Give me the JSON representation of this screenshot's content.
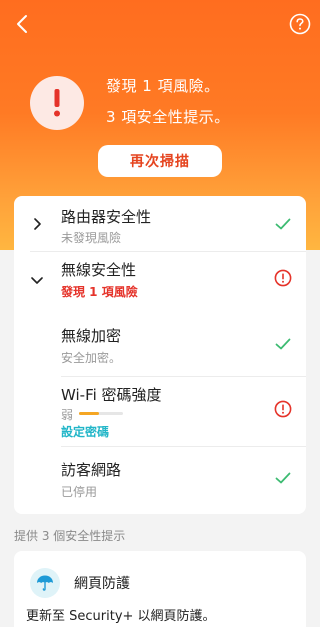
{
  "header": {
    "back_icon": "chevron-left-icon",
    "help_icon": "question-circle-icon"
  },
  "hero": {
    "alert_icon": "exclamation-icon",
    "line1": "發現 1 項風險。",
    "line2": "3 項安全性提示。",
    "rescan_label": "再次掃描",
    "colors": {
      "gradient_top": "#ff6d1f",
      "gradient_bottom": "#ffb640",
      "accent": "#e5441f"
    }
  },
  "checks": [
    {
      "title": "路由器安全性",
      "subtitle": "未發現風險",
      "status": "ok",
      "expander": "collapsed"
    },
    {
      "title": "無線安全性",
      "subtitle": "發現 1 項風險",
      "status": "risk",
      "expander": "expanded"
    },
    {
      "title": "無線加密",
      "subtitle": "安全加密。",
      "status": "ok"
    },
    {
      "title": "Wi-Fi 密碼強度",
      "subtitle": "弱",
      "strength": 0.45,
      "link": "設定密碼",
      "status": "risk"
    },
    {
      "title": "訪客網路",
      "subtitle": "已停用",
      "status": "ok"
    }
  ],
  "tips": {
    "header": "提供 3 個安全性提示",
    "items": [
      {
        "icon": "umbrella-icon",
        "title": "網頁防護",
        "description": "更新至 Security+ 以網頁防護。"
      }
    ]
  },
  "status_colors": {
    "ok": "#3dbb72",
    "risk": "#e5332a"
  }
}
